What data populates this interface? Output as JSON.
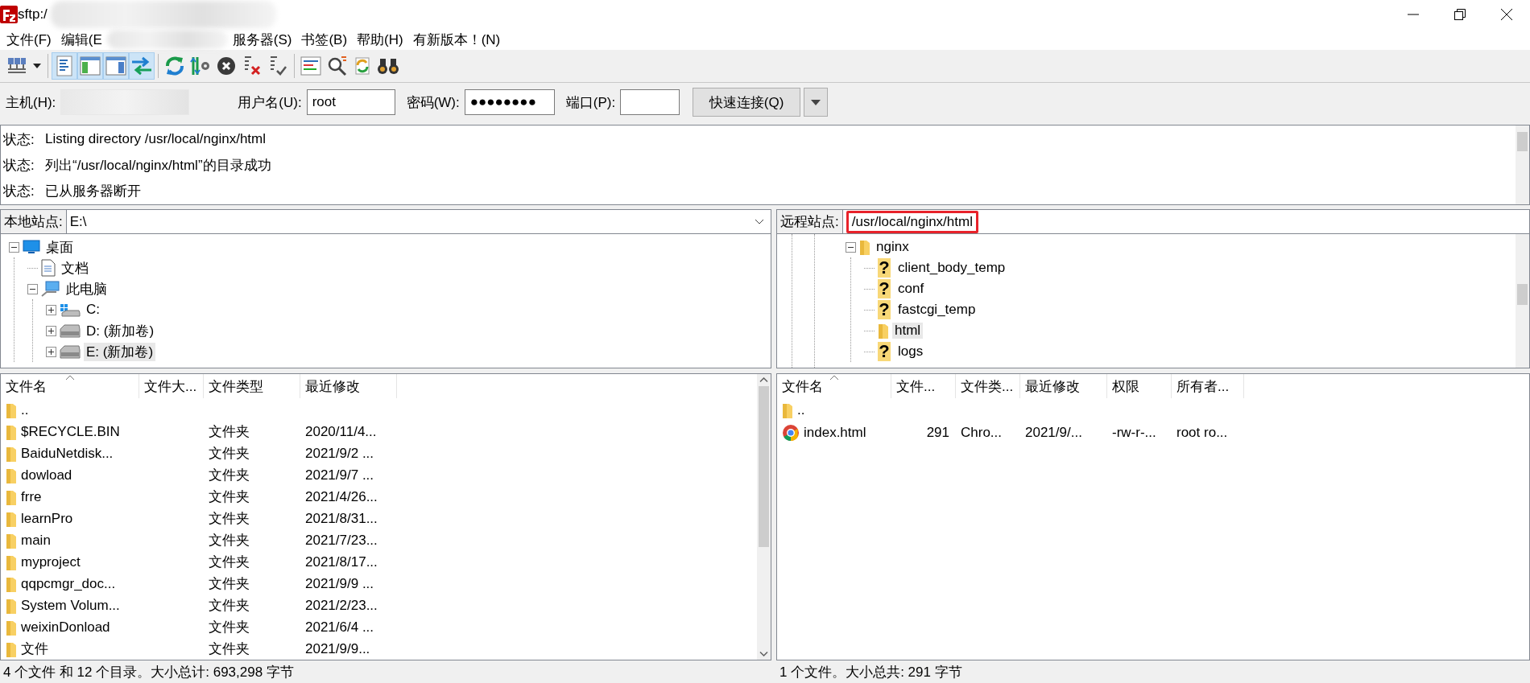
{
  "window": {
    "title": "sftp:/",
    "title_redacted": true
  },
  "menu": [
    {
      "kind": "item",
      "label": "文件(F)"
    },
    {
      "kind": "item",
      "label": "编辑(E"
    },
    {
      "kind": "redacted"
    },
    {
      "kind": "item",
      "label": "服务器(S)"
    },
    {
      "kind": "item",
      "label": "书签(B)"
    },
    {
      "kind": "item",
      "label": "帮助(H)"
    },
    {
      "kind": "item",
      "label": "有新版本！(N)"
    }
  ],
  "toolbar": [
    {
      "kind": "servers",
      "pressed": false
    },
    {
      "kind": "dropdown",
      "pressed": false
    },
    {
      "kind": "separator"
    },
    {
      "kind": "log",
      "pressed": true
    },
    {
      "kind": "localtree",
      "pressed": true
    },
    {
      "kind": "remotetree",
      "pressed": true
    },
    {
      "kind": "queue",
      "pressed": true
    },
    {
      "kind": "separator"
    },
    {
      "kind": "refresh",
      "pressed": false
    },
    {
      "kind": "process",
      "pressed": false
    },
    {
      "kind": "cancel",
      "pressed": false
    },
    {
      "kind": "disconnect",
      "pressed": false
    },
    {
      "kind": "reconnect",
      "pressed": false
    },
    {
      "kind": "separator"
    },
    {
      "kind": "compare",
      "pressed": false
    },
    {
      "kind": "filter",
      "pressed": false
    },
    {
      "kind": "sync",
      "pressed": false
    },
    {
      "kind": "binoculars",
      "pressed": false
    }
  ],
  "quickconnect": {
    "host": {
      "label": "主机(H):",
      "redacted": true
    },
    "user": {
      "label": "用户名(U):",
      "value": "root"
    },
    "password": {
      "label": "密码(W):",
      "value": "●●●●●●●●"
    },
    "port": {
      "label": "端口(P):"
    },
    "button": "快速连接(Q)"
  },
  "log": [
    {
      "label": "状态:",
      "message": "Listing directory /usr/local/nginx/html"
    },
    {
      "label": "状态:",
      "message": "列出“/usr/local/nginx/html”的目录成功"
    },
    {
      "label": "状态:",
      "message": "已从服务器断开"
    }
  ],
  "local": {
    "site_label": "本地站点:",
    "path": "E:\\",
    "tree": [
      {
        "label": "桌面",
        "kind": "desktop",
        "expanded": true,
        "selected": false,
        "children": [
          {
            "label": "文档",
            "kind": "document",
            "selected": false
          },
          {
            "label": "此电脑",
            "kind": "computer",
            "expanded": true,
            "selected": false,
            "children": [
              {
                "label": "C:",
                "kind": "systemdrive",
                "expanded": false,
                "selected": false
              },
              {
                "label": "D: (新加卷)",
                "kind": "drive",
                "expanded": false,
                "selected": false
              },
              {
                "label": "E: (新加卷)",
                "kind": "drive",
                "expanded": false,
                "selected": true
              }
            ]
          }
        ]
      }
    ],
    "columns": [
      {
        "label": "文件名",
        "sorted": true
      },
      {
        "label": "文件大...",
        "sorted": false
      },
      {
        "label": "文件类型",
        "sorted": false
      },
      {
        "label": "最近修改",
        "sorted": false
      }
    ],
    "rows": [
      {
        "kind": "folder",
        "name": ".."
      },
      {
        "kind": "folder",
        "name": "$RECYCLE.BIN",
        "type": "文件夹",
        "modified": "2020/11/4..."
      },
      {
        "kind": "folder",
        "name": "BaiduNetdisk...",
        "type": "文件夹",
        "modified": "2021/9/2 ..."
      },
      {
        "kind": "folder",
        "name": "dowload",
        "type": "文件夹",
        "modified": "2021/9/7 ..."
      },
      {
        "kind": "folder",
        "name": "frre",
        "type": "文件夹",
        "modified": "2021/4/26..."
      },
      {
        "kind": "folder",
        "name": "learnPro",
        "type": "文件夹",
        "modified": "2021/8/31..."
      },
      {
        "kind": "folder",
        "name": "main",
        "type": "文件夹",
        "modified": "2021/7/23..."
      },
      {
        "kind": "folder",
        "name": "myproject",
        "type": "文件夹",
        "modified": "2021/8/17..."
      },
      {
        "kind": "folder",
        "name": "qqpcmgr_doc...",
        "type": "文件夹",
        "modified": "2021/9/9 ..."
      },
      {
        "kind": "folder",
        "name": "System Volum...",
        "type": "文件夹",
        "modified": "2021/2/23..."
      },
      {
        "kind": "folder",
        "name": "weixinDonload",
        "type": "文件夹",
        "modified": "2021/6/4 ..."
      },
      {
        "kind": "folder",
        "name": "文件",
        "type": "文件夹",
        "modified": "2021/9/9..."
      }
    ],
    "status": "4 个文件 和 12 个目录。大小总计: 693,298 字节"
  },
  "remote": {
    "site_label": "远程站点:",
    "path": "/usr/local/nginx/html",
    "path_highlighted": true,
    "tree": [
      {
        "label": "nginx",
        "kind": "folder",
        "expanded": true,
        "selected": false,
        "children": [
          {
            "label": "client_body_temp",
            "kind": "unknown",
            "symbol": "?",
            "selected": false
          },
          {
            "label": "conf",
            "kind": "unknown",
            "symbol": "?",
            "selected": false
          },
          {
            "label": "fastcgi_temp",
            "kind": "unknown",
            "symbol": "?",
            "selected": false
          },
          {
            "label": "html",
            "kind": "folder",
            "selected": true
          },
          {
            "label": "logs",
            "kind": "unknown",
            "symbol": "?",
            "selected": false
          }
        ]
      }
    ],
    "columns": [
      {
        "label": "文件名",
        "sorted": true
      },
      {
        "label": "文件...",
        "sorted": false
      },
      {
        "label": "文件类...",
        "sorted": false
      },
      {
        "label": "最近修改",
        "sorted": false
      },
      {
        "label": "权限",
        "sorted": false
      },
      {
        "label": "所有者...",
        "sorted": false
      }
    ],
    "rows": [
      {
        "kind": "folder",
        "name": ".."
      },
      {
        "kind": "webpage",
        "name": "index.html",
        "size": "291",
        "type": "Chro...",
        "modified": "2021/9/...",
        "permissions": "-rw-r-...",
        "owner": "root ro..."
      }
    ],
    "status": "1 个文件。大小总共: 291 字节"
  }
}
